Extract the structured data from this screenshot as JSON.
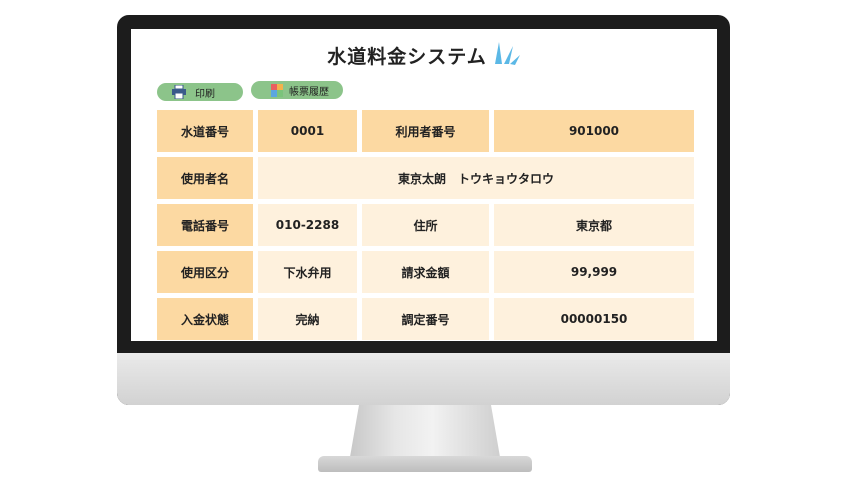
{
  "app": {
    "title": "水道料金システム"
  },
  "toolbar": {
    "print_label": "印刷",
    "history_label": "帳票履歴"
  },
  "record": {
    "water_no_label": "水道番号",
    "water_no": "0001",
    "user_no_label": "利用者番号",
    "user_no": "901000",
    "user_name_label": "使用者名",
    "user_name": "東京太朗　トウキョウタロウ",
    "phone_label": "電話番号",
    "phone": "010-2288",
    "address_label": "住所",
    "address": "東京都",
    "usage_label": "使用区分",
    "usage": "下水弁用",
    "amount_label": "請求金額",
    "amount": "99,999",
    "payment_label": "入金状態",
    "payment": "完納",
    "adjust_label": "調定番号",
    "adjust_no": "00000150"
  },
  "colors": {
    "header_cell": "#fcd9a2",
    "value_cell": "#fef1dd",
    "button": "#8cc48a",
    "monitor_bezel": "#1c1c1c",
    "accent_splash": "#5bb8e6"
  },
  "icons": {
    "print": "printer-icon",
    "history": "report-history-icon",
    "title_decoration": "water-splash-icon"
  }
}
